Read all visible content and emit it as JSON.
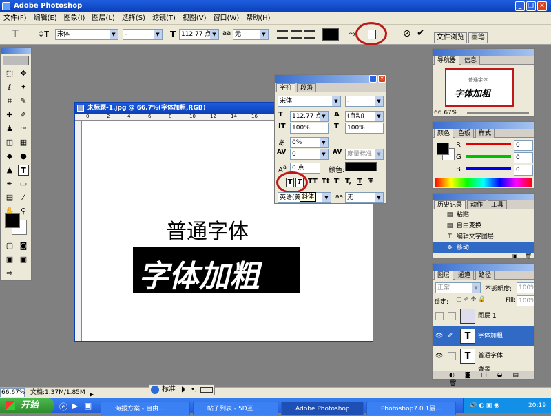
{
  "app": {
    "title": "Adobe Photoshop"
  },
  "menu": [
    "文件(F)",
    "编辑(E)",
    "图象(I)",
    "图层(L)",
    "选择(S)",
    "滤镜(T)",
    "视图(V)",
    "窗口(W)",
    "帮助(H)"
  ],
  "options": {
    "font_family": "宋体",
    "font_style": "-",
    "font_size": "112.77 点",
    "antialias": "无",
    "right_tabs": [
      "文件浏览",
      "画笔"
    ]
  },
  "document": {
    "title": "未标题-1.jpg @ 66.7%(字体加粗,RGB)",
    "ruler_ticks": [
      "0",
      "2",
      "4",
      "6",
      "8",
      "10",
      "12",
      "14",
      "16"
    ],
    "text_normal": "普通字体",
    "text_bold": "字体加粗"
  },
  "char_panel": {
    "tabs": [
      "字符",
      "段落"
    ],
    "font": "宋体",
    "style": "-",
    "size": "112.77 点",
    "leading": "(自动)",
    "vscale": "100%",
    "hscale": "100%",
    "tracking": "0%",
    "kerning": "0",
    "kerning_metric": "度量标准",
    "baseline": "0 点",
    "color_label": "颜色:",
    "language": "英语(美",
    "tooltip": "斜体",
    "antialias": "无",
    "style_buttons": [
      "T",
      "T",
      "TT",
      "Tt",
      "T'",
      "T,",
      "T",
      "Ŧ"
    ]
  },
  "navigator": {
    "tabs": [
      "导航器",
      "信息"
    ],
    "zoom": "66.67%",
    "preview_normal": "普通字体",
    "preview_bold": "字体加粗"
  },
  "color_panel": {
    "tabs": [
      "颜色",
      "色板",
      "样式"
    ],
    "channels": [
      {
        "label": "R",
        "value": "0",
        "color": "#e00000"
      },
      {
        "label": "G",
        "value": "0",
        "color": "#00c000"
      },
      {
        "label": "B",
        "value": "0",
        "color": "#0000e0"
      }
    ]
  },
  "history": {
    "tabs": [
      "历史记录",
      "动作",
      "工具"
    ],
    "items": [
      {
        "label": "粘贴",
        "icon": "doc-icon"
      },
      {
        "label": "自由变换",
        "icon": "doc-icon"
      },
      {
        "label": "编辑文字图层",
        "icon": "type-icon"
      },
      {
        "label": "移动",
        "icon": "move-icon"
      }
    ]
  },
  "layers": {
    "tabs": [
      "图层",
      "通道",
      "路径"
    ],
    "blend": "正常",
    "opacity_label": "不透明度:",
    "opacity": "100%",
    "lock_label": "锁定:",
    "fill_label": "Fill:",
    "fill": "100%",
    "items": [
      {
        "name": "图层 1",
        "thumb": "img",
        "selected": false
      },
      {
        "name": "字体加粗",
        "thumb": "T",
        "selected": true
      },
      {
        "name": "普通字体",
        "thumb": "T",
        "selected": false
      },
      {
        "name": "背景",
        "thumb": "bg",
        "selected": false
      }
    ]
  },
  "status": {
    "zoom": "66.67%",
    "doc": "文档:1.37M/1.85M"
  },
  "ime": {
    "label": "标准"
  },
  "taskbar": {
    "start": "开始",
    "items": [
      "海报方案 - 自由...",
      "帖子列表 - 5D互...",
      "Adobe Photoshop",
      "Photoshop7.0.1最..."
    ],
    "time": "20:19"
  },
  "colors": {
    "title_blue": "#0a3fb8",
    "panel_bg": "#ece9d8",
    "accent_red": "#c01818",
    "selected_row": "#316ac5"
  }
}
